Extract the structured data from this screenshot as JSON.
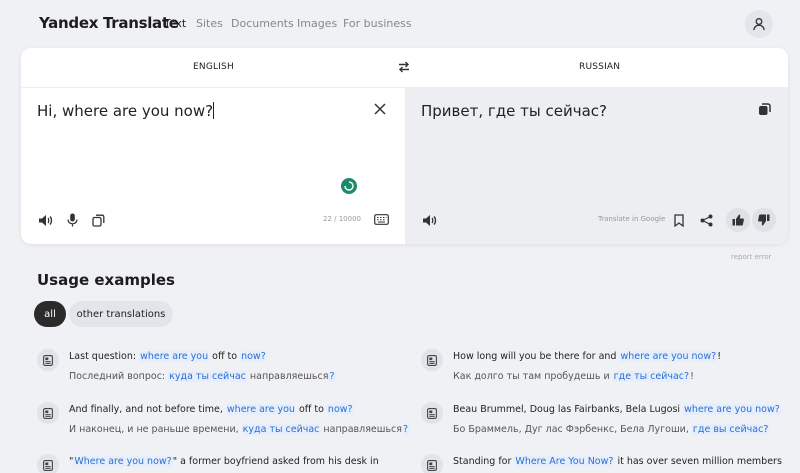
{
  "header": {
    "logo": "Yandex Translate",
    "nav": [
      "Text",
      "Sites",
      "Documents",
      "Images",
      "For business"
    ],
    "active_nav": "Text"
  },
  "translator": {
    "source_lang": "ENGLISH",
    "target_lang": "RUSSIAN",
    "source_text": "Hi, where are you now?",
    "target_text": "Привет, где ты сейчас?",
    "char_count": "22 / 10000",
    "translate_in_google": "Translate in Google",
    "report_error": "report error"
  },
  "usage": {
    "title": "Usage examples",
    "chips": {
      "all": "all",
      "other": "other translations"
    },
    "examples": [
      {
        "en": [
          [
            "Last question: ",
            false
          ],
          [
            "where are you",
            true
          ],
          [
            " off to ",
            false
          ],
          [
            "now?",
            true
          ]
        ],
        "ru": [
          [
            "Последний вопрос: ",
            false
          ],
          [
            "куда ты сейчас",
            true
          ],
          [
            " направляешься",
            false
          ],
          [
            "?",
            true
          ]
        ]
      },
      {
        "en": [
          [
            "How long will you be there for and ",
            false
          ],
          [
            "where are you now?",
            true
          ],
          [
            "!",
            false
          ]
        ],
        "ru": [
          [
            "Как долго ты там пробудешь и ",
            false
          ],
          [
            "где ты сейчас?",
            true
          ],
          [
            "!",
            false
          ]
        ]
      },
      {
        "en": [
          [
            "And finally, and not before time, ",
            false
          ],
          [
            "where are you",
            true
          ],
          [
            " off to ",
            false
          ],
          [
            "now?",
            true
          ]
        ],
        "ru": [
          [
            "И наконец, и не раньше времени, ",
            false
          ],
          [
            "куда ты сейчас",
            true
          ],
          [
            " направляешься",
            false
          ],
          [
            "?",
            true
          ]
        ]
      },
      {
        "en": [
          [
            "Beau Brummel, Doug las Fairbanks, Bela Lugosi ",
            false
          ],
          [
            "where are you now?",
            true
          ]
        ],
        "ru": [
          [
            "Бо Браммель, Дуг лас Фэрбенкс, Бела Лугоши, ",
            false
          ],
          [
            "где вы сейчас?",
            true
          ]
        ]
      },
      {
        "en": [
          [
            "\"",
            false
          ],
          [
            "Where are you now?",
            true
          ],
          [
            "\" a former boyfriend asked from his desk in",
            false
          ]
        ],
        "ru": []
      },
      {
        "en": [
          [
            "Standing for ",
            false
          ],
          [
            "Where Are You Now?",
            true
          ],
          [
            " it has over seven million members",
            false
          ]
        ],
        "ru": []
      }
    ]
  },
  "colors": {
    "accent": "#2a6fd6",
    "highlight_bg": "#e7eefb",
    "page_bg": "#f0f1f4"
  }
}
